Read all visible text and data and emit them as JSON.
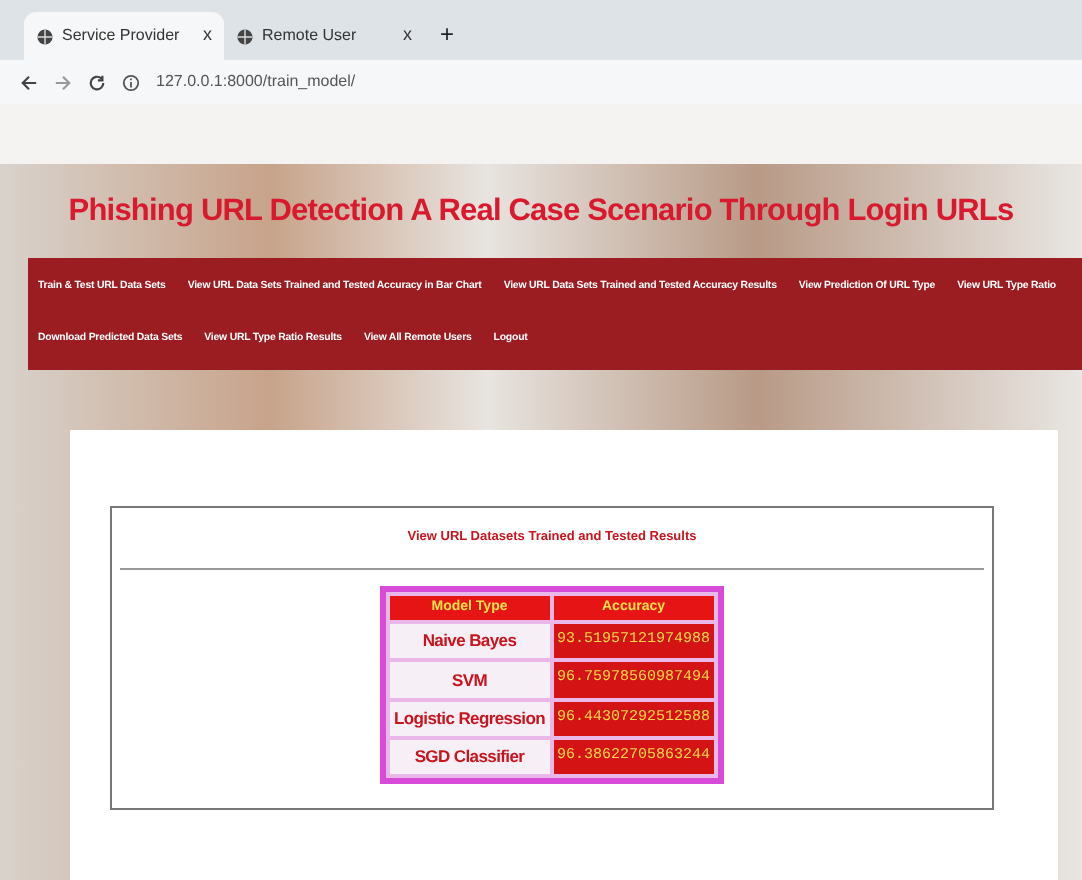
{
  "browser": {
    "tabs": [
      {
        "title": "Service Provider",
        "selected": true,
        "close": "x"
      },
      {
        "title": "Remote User",
        "selected": false,
        "close": "x"
      }
    ],
    "new_tab": "+",
    "url": "127.0.0.1:8000/train_model/"
  },
  "page": {
    "title": "Phishing URL Detection A Real Case Scenario Through Login URLs",
    "nav": [
      "Train & Test URL Data Sets",
      "View URL Data Sets Trained and Tested Accuracy in Bar Chart",
      "View URL Data Sets Trained and Tested Accuracy Results",
      "View Prediction Of URL Type",
      "View URL Type Ratio",
      "Download Predicted Data Sets",
      "View URL Type Ratio Results",
      "View All Remote Users",
      "Logout"
    ],
    "panel": {
      "heading": "View URL Datasets Trained and Tested Results",
      "table": {
        "columns": [
          "Model Type",
          "Accuracy"
        ],
        "rows": [
          [
            "Naive Bayes",
            "93.51957121974988"
          ],
          [
            "SVM",
            "96.75978560987494"
          ],
          [
            "Logistic Regression",
            "96.44307292512588"
          ],
          [
            "SGD Classifier",
            "96.38622705863244"
          ]
        ]
      }
    }
  }
}
